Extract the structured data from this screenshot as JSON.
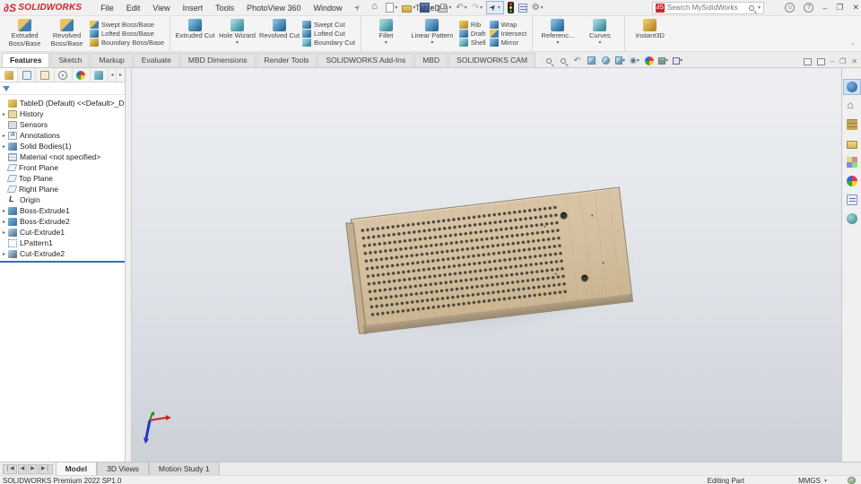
{
  "titlebar": {
    "brand": "SOLIDWORKS",
    "menus": [
      "File",
      "Edit",
      "View",
      "Insert",
      "Tools",
      "PhotoView 360",
      "Window"
    ],
    "title": "TableD *",
    "search_placeholder": "Search MySolidWorks"
  },
  "ribbon_tabs": [
    "Features",
    "Sketch",
    "Markup",
    "Evaluate",
    "MBD Dimensions",
    "Render Tools",
    "SOLIDWORKS Add-Ins",
    "MBD",
    "SOLIDWORKS CAM"
  ],
  "ribbon": {
    "g1": {
      "big0": "Extruded Boss/Base",
      "big1": "Revolved Boss/Base",
      "s0": "Swept Boss/Base",
      "s1": "Lofted Boss/Base",
      "s2": "Boundary Boss/Base"
    },
    "g2": {
      "big0": "Extruded Cut",
      "big1": "Hole Wizard",
      "big2": "Revolved Cut",
      "s0": "Swept Cut",
      "s1": "Lofted Cut",
      "s2": "Boundary Cut"
    },
    "g3": {
      "big0": "Fillet",
      "big1": "Linear Pattern",
      "a0": "Rib",
      "a1": "Draft",
      "a2": "Shell",
      "b0": "Wrap",
      "b1": "Intersect",
      "b2": "Mirror"
    },
    "g4": {
      "big0": "Referenc...",
      "big1": "Curves"
    },
    "g5": {
      "big0": "Instant3D"
    }
  },
  "tree": {
    "root": "TableD (Default) <<Default>_Displa",
    "items": [
      {
        "label": "History"
      },
      {
        "label": "Sensors"
      },
      {
        "label": "Annotations"
      },
      {
        "label": "Solid Bodies(1)"
      },
      {
        "label": "Material <not specified>"
      },
      {
        "label": "Front Plane"
      },
      {
        "label": "Top Plane"
      },
      {
        "label": "Right Plane"
      },
      {
        "label": "Origin"
      },
      {
        "label": "Boss-Extrude1"
      },
      {
        "label": "Boss-Extrude2"
      },
      {
        "label": "Cut-Extrude1"
      },
      {
        "label": "LPattern1"
      },
      {
        "label": "Cut-Extrude2"
      }
    ]
  },
  "bottom_tabs": {
    "t0": "Model",
    "t1": "3D Views",
    "t2": "Motion Study 1"
  },
  "statusbar": {
    "left": "SOLIDWORKS Premium 2022 SP1.0",
    "mode": "Editing Part",
    "units": "MMGS"
  },
  "colors": {
    "brand_red": "#d1232a",
    "board_top": "#d2bd9c",
    "board_side": "#9a8a6e",
    "hole": "#45433a",
    "accent_blue": "#2f6fc1"
  }
}
